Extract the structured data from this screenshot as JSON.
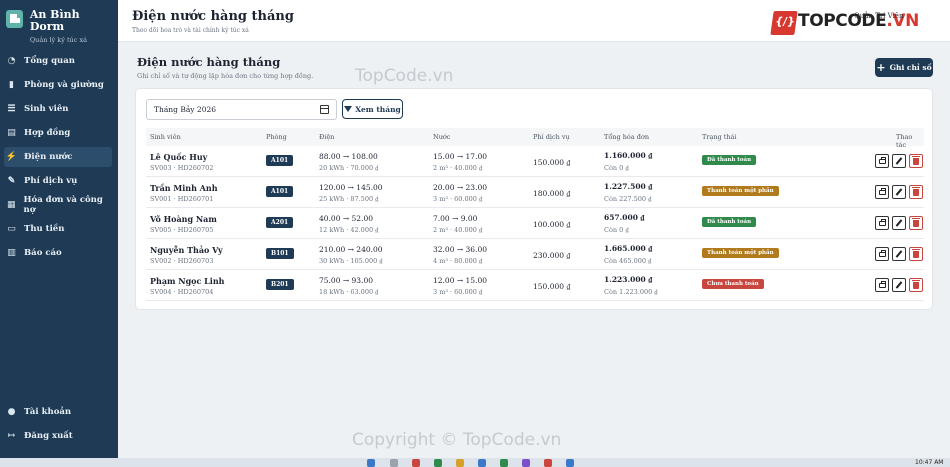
{
  "app": {
    "name": "An Bình Dorm",
    "subtitle": "Quản lý ký túc xá"
  },
  "sidebar": {
    "items": [
      {
        "label": "Tổng quan",
        "icon": "gauge-icon"
      },
      {
        "label": "Phòng và giường",
        "icon": "door-icon"
      },
      {
        "label": "Sinh viên",
        "icon": "users-icon"
      },
      {
        "label": "Hợp đồng",
        "icon": "document-icon"
      },
      {
        "label": "Điện nước",
        "icon": "bolt-icon"
      },
      {
        "label": "Phí dịch vụ",
        "icon": "tools-icon"
      },
      {
        "label": "Hóa đơn và công nợ",
        "icon": "invoice-icon"
      },
      {
        "label": "Thu tiền",
        "icon": "wallet-icon"
      },
      {
        "label": "Báo cáo",
        "icon": "chart-icon"
      }
    ],
    "bottom": [
      {
        "label": "Tài khoản",
        "icon": "user-icon"
      },
      {
        "label": "Đăng xuất",
        "icon": "logout-icon"
      }
    ],
    "active": "Điện nước"
  },
  "header": {
    "title": "Điện nước hàng tháng",
    "subtitle": "Theo dõi hoa trò và tài chính ký túc xá",
    "user": "Quản Trị Viên",
    "brand_watermark": "TOPCODE.VN"
  },
  "main": {
    "title": "Điện nước hàng tháng",
    "subtitle": "Ghi chỉ số và tự động lập hóa đơn cho từng hợp đồng.",
    "add_button": "Ghi chỉ số",
    "month_value": "Tháng Bảy 2026",
    "view_button": "Xem tháng"
  },
  "table": {
    "headers": [
      "Sinh viên",
      "Phòng",
      "Điện",
      "Nước",
      "Phí dịch vụ",
      "Tổng hóa đơn",
      "Trạng thái",
      "Thao tác"
    ],
    "rows": [
      {
        "name": "Lê Quốc Huy",
        "code": "SV003 · HD260702",
        "room": "A101",
        "elec": "88.00 → 108.00",
        "elec_sub": "20 kWh · 70.000 ₫",
        "water": "15.00 → 17.00",
        "water_sub": "2 m³ · 40.000 ₫",
        "service": "150.000 ₫",
        "total": "1.160.000 ₫",
        "remain": "Còn 0 ₫",
        "status": "Đã thanh toán",
        "status_color": "#2f8a4b"
      },
      {
        "name": "Trần Minh Anh",
        "code": "SV001 · HD260701",
        "room": "A101",
        "elec": "120.00 → 145.00",
        "elec_sub": "25 kWh · 87.500 ₫",
        "water": "20.00 → 23.00",
        "water_sub": "3 m³ · 60.000 ₫",
        "service": "180.000 ₫",
        "total": "1.227.500 ₫",
        "remain": "Còn 227.500 ₫",
        "status": "Thanh toán một phần",
        "status_color": "#b07a1d"
      },
      {
        "name": "Võ Hoàng Nam",
        "code": "SV005 · HD260705",
        "room": "A201",
        "elec": "40.00 → 52.00",
        "elec_sub": "12 kWh · 42.000 ₫",
        "water": "7.00 → 9.00",
        "water_sub": "2 m³ · 40.000 ₫",
        "service": "100.000 ₫",
        "total": "657.000 ₫",
        "remain": "Còn 0 ₫",
        "status": "Đã thanh toán",
        "status_color": "#2f8a4b"
      },
      {
        "name": "Nguyễn Thảo Vy",
        "code": "SV002 · HD260703",
        "room": "B101",
        "elec": "210.00 → 240.00",
        "elec_sub": "30 kWh · 105.000 ₫",
        "water": "32.00 → 36.00",
        "water_sub": "4 m³ · 80.000 ₫",
        "service": "230.000 ₫",
        "total": "1.665.000 ₫",
        "remain": "Còn 465.000 ₫",
        "status": "Thanh toán một phần",
        "status_color": "#b07a1d"
      },
      {
        "name": "Phạm Ngọc Linh",
        "code": "SV004 · HD260704",
        "room": "B201",
        "elec": "75.00 → 93.00",
        "elec_sub": "18 kWh · 63.000 ₫",
        "water": "12.00 → 15.00",
        "water_sub": "3 m³ · 60.000 ₫",
        "service": "150.000 ₫",
        "total": "1.223.000 ₫",
        "remain": "Còn 1.223.000 ₫",
        "status": "Chưa thanh toán",
        "status_color": "#c9463f"
      }
    ]
  },
  "watermarks": {
    "top": "TopCode.vn",
    "bottom": "Copyright © TopCode.vn"
  },
  "taskbar": {
    "time": "10:47 AM"
  }
}
